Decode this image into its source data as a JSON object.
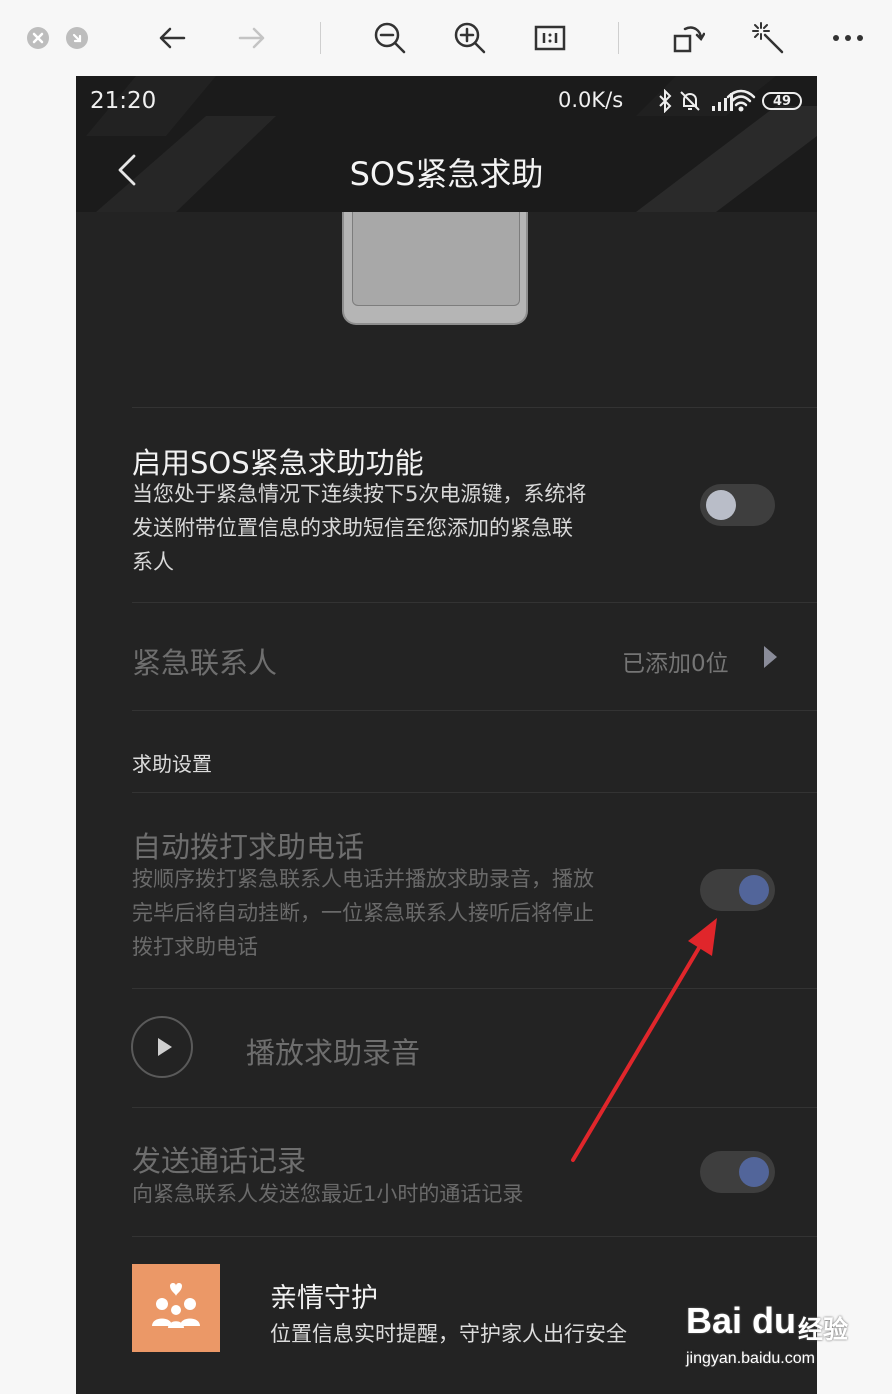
{
  "status_bar": {
    "time": "21:20",
    "net_speed": "0.0K/s",
    "battery": "49",
    "icons": [
      "bluetooth-icon",
      "mute-icon",
      "signal-icon",
      "wifi-icon",
      "battery-icon"
    ]
  },
  "header": {
    "title": "SOS紧急求助",
    "back_icon": "chevron-left-icon"
  },
  "sos_toggle": {
    "title": "启用SOS紧急求助功能",
    "desc_lines": [
      "当您处于紧急情况下连续按下5次电源键，系统将",
      "发送附带位置信息的求助短信至您添加的紧急联",
      "系人"
    ],
    "enabled": false
  },
  "contacts": {
    "label": "紧急联系人",
    "value": "已添加0位"
  },
  "section": {
    "header": "求助设置"
  },
  "auto_call": {
    "title": "自动拨打求助电话",
    "desc_lines": [
      "按顺序拨打紧急联系人电话并播放求助录音，播放",
      "完毕后将自动挂断，一位紧急联系人接听后将停止",
      "拨打求助电话"
    ],
    "enabled": true
  },
  "play_recording": {
    "label": "播放求助录音"
  },
  "send_log": {
    "title": "发送通话记录",
    "desc": "向紧急联系人发送您最近1小时的通话记录",
    "enabled": true
  },
  "family_guard": {
    "title": "亲情守护",
    "desc": "位置信息实时提醒，守护家人出行安全"
  },
  "colors": {
    "background": "#232323",
    "toggle_on_knob": "#52659a",
    "toggle_off_knob": "#b9bdc8",
    "family_icon_bg": "#eb9867",
    "annotation_arrow": "#e0262b"
  },
  "watermark": {
    "brand": "Bai du",
    "suffix": "经验",
    "url": "jingyan.baidu.com"
  }
}
